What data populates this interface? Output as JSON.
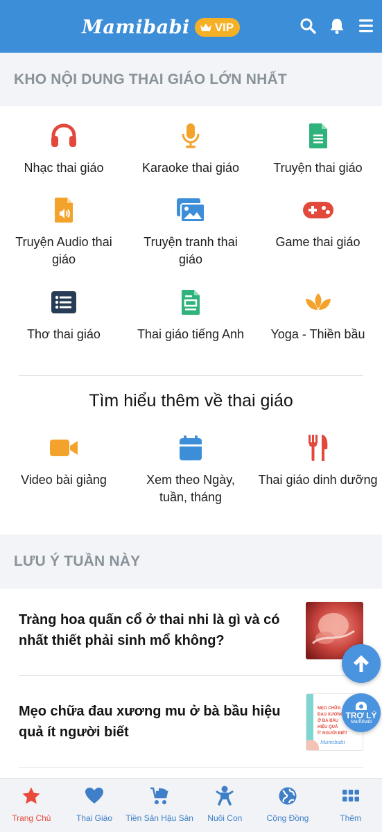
{
  "header": {
    "logo_text": "Mamibabi",
    "vip_label": "VIP",
    "icons": [
      "search-icon",
      "bell-icon",
      "menu-icon"
    ],
    "color": "#3d8ed8"
  },
  "section1": {
    "title": "KHO NỘI DUNG THAI GIÁO LỚN NHẤT",
    "items": [
      {
        "label": "Nhạc thai giáo",
        "icon": "headphones-icon",
        "color": "#e2493c"
      },
      {
        "label": "Karaoke thai giáo",
        "icon": "microphone-icon",
        "color": "#f3a32b"
      },
      {
        "label": "Truyện thai giáo",
        "icon": "document-icon",
        "color": "#2fb27b"
      },
      {
        "label": "Truyện Audio thai giáo",
        "icon": "audio-file-icon",
        "color": "#f3a32b"
      },
      {
        "label": "Truyện tranh thai giáo",
        "icon": "images-icon",
        "color": "#3d8ed8"
      },
      {
        "label": "Game thai giáo",
        "icon": "gamepad-icon",
        "color": "#e2493c"
      },
      {
        "label": "Thơ thai giáo",
        "icon": "list-icon",
        "color": "#273d56"
      },
      {
        "label": "Thai giáo tiếng Anh",
        "icon": "file-text-icon",
        "color": "#2fb27b"
      },
      {
        "label": "Yoga - Thiền bầu",
        "icon": "lotus-icon",
        "color": "#f3a32b"
      }
    ]
  },
  "section2": {
    "title": "Tìm hiểu thêm về thai giáo",
    "items": [
      {
        "label": "Video bài giảng",
        "icon": "video-camera-icon",
        "color": "#f3a32b"
      },
      {
        "label": "Xem theo Ngày, tuần, tháng",
        "icon": "calendar-icon",
        "color": "#3d8ed8"
      },
      {
        "label": "Thai giáo dinh dưỡng",
        "icon": "utensils-icon",
        "color": "#e2493c"
      }
    ]
  },
  "section3": {
    "title": "LƯU Ý TUẦN NÀY",
    "articles": [
      {
        "title": "Tràng hoa quấn cổ ở thai nhi là gì và có nhất thiết phải sinh mổ không?"
      },
      {
        "title": "Mẹo chữa đau xương mu ở bà bầu hiệu quả ít người biết",
        "thumb_lines": [
          "MẸO CHỮA",
          "ĐAU XƯƠNG",
          "Ở BÀ BẦU",
          "HIỆU QUẢ",
          "ÍT NGƯỜI BIẾT"
        ],
        "thumb_brand": "Mamibabi"
      }
    ]
  },
  "floating": {
    "scroll_top_icon": "arrow-up-icon",
    "assistant_label": "TRỢ LÝ",
    "assistant_brand": "Mamibabi"
  },
  "bottom_nav": {
    "items": [
      {
        "label": "Trang Chủ",
        "icon": "star-icon",
        "active": true
      },
      {
        "label": "Thai Giáo",
        "icon": "heart-icon",
        "active": false
      },
      {
        "label": "Tiền Sản Hậu Sản",
        "icon": "stroller-icon",
        "active": false
      },
      {
        "label": "Nuôi Con",
        "icon": "baby-icon",
        "active": false
      },
      {
        "label": "Cộng Đồng",
        "icon": "globe-icon",
        "active": false
      },
      {
        "label": "Thêm",
        "icon": "grid-icon",
        "active": false
      }
    ],
    "active_color": "#e84a3c",
    "inactive_color": "#3e7fc8"
  }
}
